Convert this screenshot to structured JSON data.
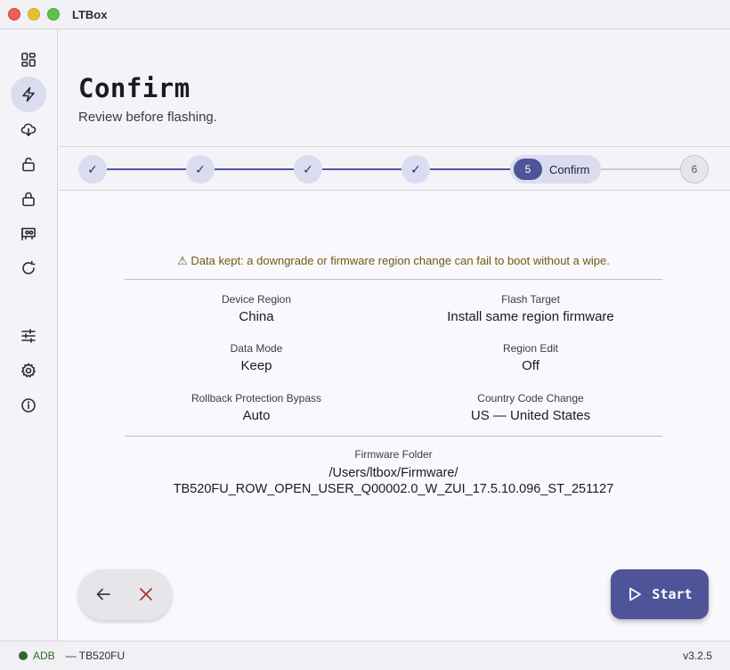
{
  "window": {
    "title": "LTBox"
  },
  "sidebar": {
    "items": [
      {
        "icon": "dashboard-icon",
        "active": false
      },
      {
        "icon": "flash-icon",
        "active": true
      },
      {
        "icon": "cloud-download-icon",
        "active": false
      },
      {
        "icon": "unlock-icon",
        "active": false
      },
      {
        "icon": "lock-icon",
        "active": false
      },
      {
        "icon": "device-icon",
        "active": false
      },
      {
        "icon": "refresh-icon",
        "active": false
      },
      {
        "icon": "sliders-icon",
        "active": false
      },
      {
        "icon": "gear-icon",
        "active": false
      },
      {
        "icon": "info-icon",
        "active": false
      }
    ]
  },
  "header": {
    "title": "Confirm",
    "subtitle": "Review before flashing."
  },
  "stepper": {
    "done_mark": "✓",
    "current_number": "5",
    "current_label": "Confirm",
    "pending_number": "6"
  },
  "main": {
    "warning": "⚠ Data kept: a downgrade or firmware region change can fail to boot without a wipe.",
    "fields": {
      "device_region": {
        "label": "Device Region",
        "value": "China"
      },
      "flash_target": {
        "label": "Flash Target",
        "value": "Install same region firmware"
      },
      "data_mode": {
        "label": "Data Mode",
        "value": "Keep"
      },
      "region_edit": {
        "label": "Region Edit",
        "value": "Off"
      },
      "rollback": {
        "label": "Rollback Protection Bypass",
        "value": "Auto"
      },
      "country_code": {
        "label": "Country Code Change",
        "value": "US — United States"
      }
    },
    "firmware_folder": {
      "label": "Firmware Folder",
      "line1": "/Users/ltbox/Firmware/",
      "line2": "TB520FU_ROW_OPEN_USER_Q00002.0_W_ZUI_17.5.10.096_ST_251127"
    },
    "start_label": "Start"
  },
  "status": {
    "adb": "ADB",
    "device": "— TB520FU",
    "version": "v3.2.5",
    "connected_color": "#2f6a2c"
  }
}
